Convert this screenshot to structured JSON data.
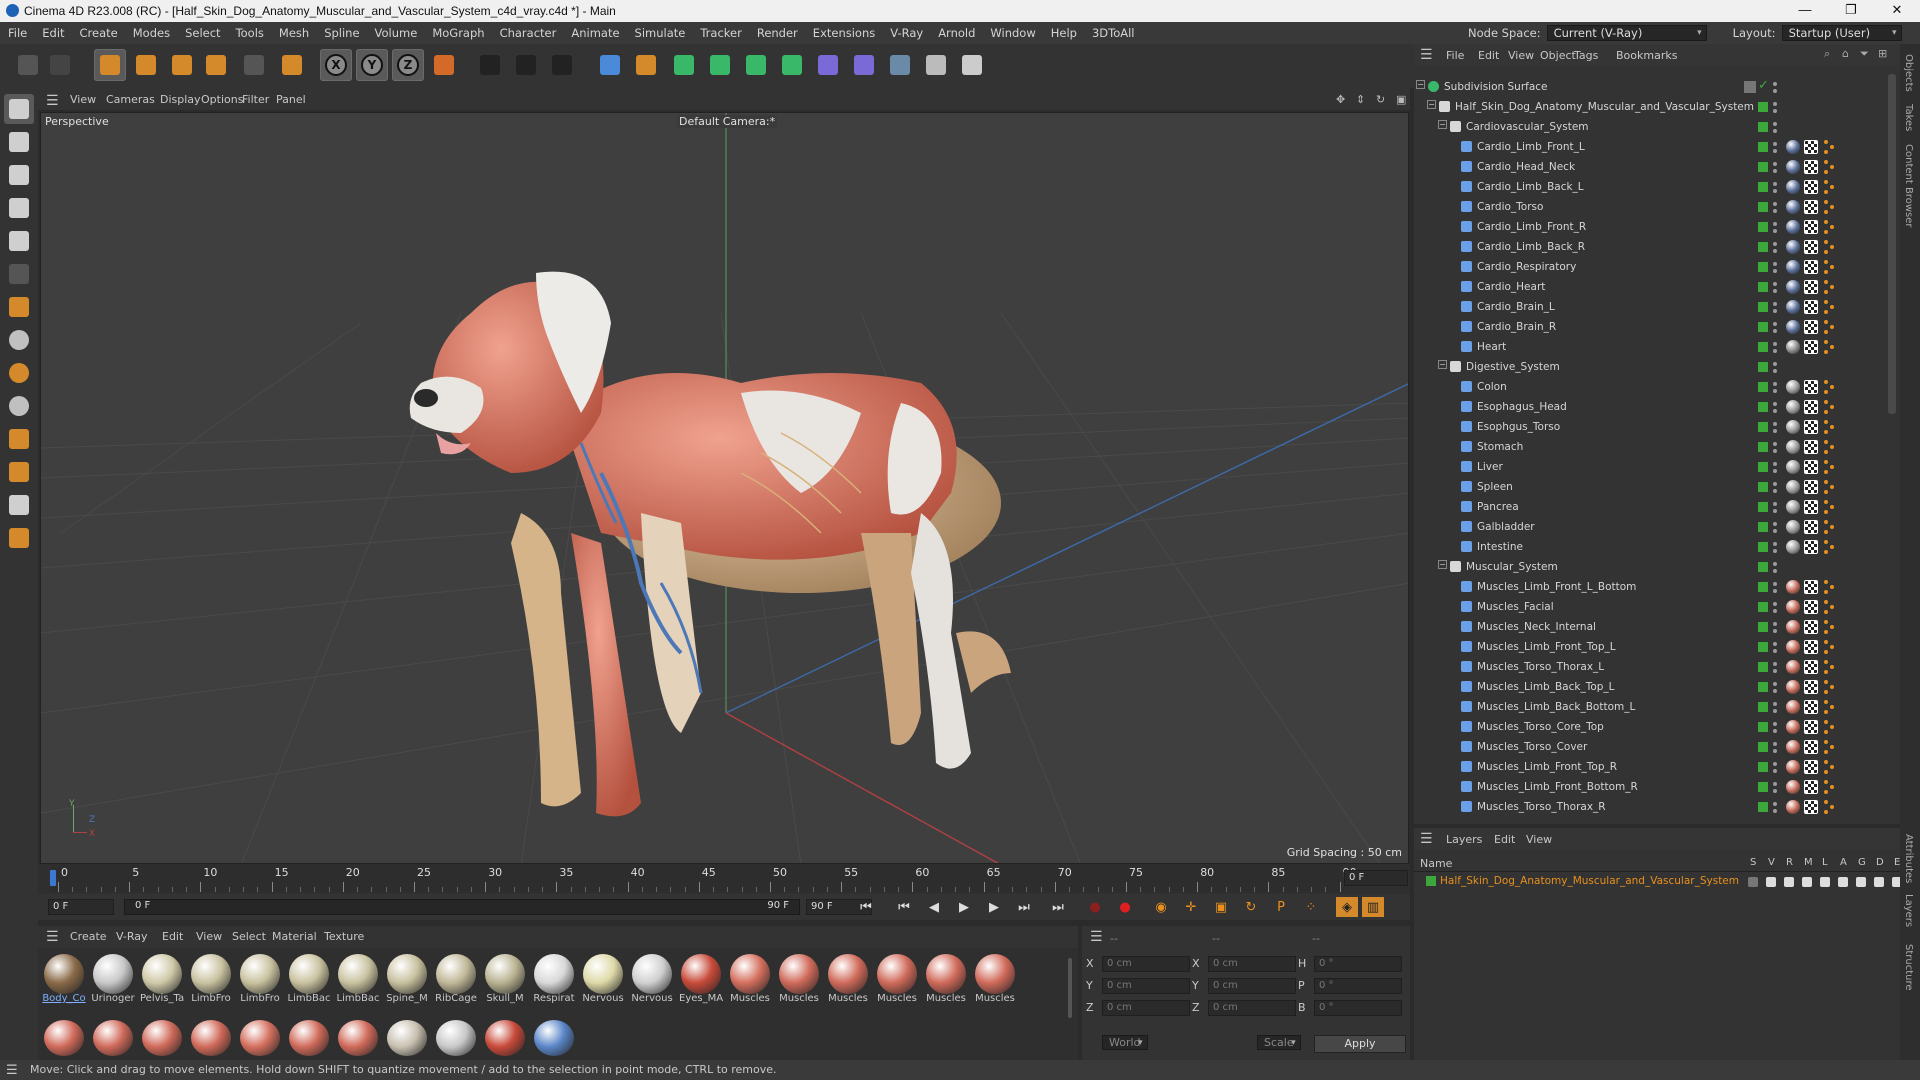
{
  "window": {
    "title": "Cinema 4D R23.008 (RC) - [Half_Skin_Dog_Anatomy_Muscular_and_Vascular_System_c4d_vray.c4d *] - Main",
    "minimize": "—",
    "maximize": "❐",
    "close": "✕"
  },
  "menubar": {
    "items": [
      "File",
      "Edit",
      "Create",
      "Modes",
      "Select",
      "Tools",
      "Mesh",
      "Spline",
      "Volume",
      "MoGraph",
      "Character",
      "Animate",
      "Simulate",
      "Tracker",
      "Render",
      "Extensions",
      "V-Ray",
      "Arnold",
      "Window",
      "Help",
      "3DToAll"
    ],
    "node_space_label": "Node Space:",
    "node_space_value": "Current (V-Ray)",
    "layout_label": "Layout:",
    "layout_value": "Startup (User)"
  },
  "toolbar": {
    "icons": [
      "undo-icon",
      "redo-icon",
      "live-selection-icon",
      "move-icon",
      "scale-icon",
      "rotate-icon",
      "recent-tools-icon",
      "add-icon",
      "x-axis-icon",
      "y-axis-icon",
      "z-axis-icon",
      "coordinate-system-icon",
      "render-view-icon",
      "render-picture-viewer-icon",
      "render-settings-icon",
      "cube-icon",
      "pen-icon",
      "subdivision-icon",
      "extrude-icon",
      "cloner-icon",
      "mograph-icon",
      "deformer-icon",
      "field-icon",
      "floor-icon",
      "camera-icon",
      "light-icon"
    ],
    "axis_x": "X",
    "axis_y": "Y",
    "axis_z": "Z"
  },
  "left_tools": [
    "model-mode-icon",
    "texture-mode-icon",
    "points-mode-icon",
    "edges-mode-icon",
    "polygons-mode-icon",
    "object-mode-icon",
    "axis-mode-icon",
    "snap-icon",
    "snap-settings-icon",
    "solo-icon",
    "tweak-icon",
    "workplane-icon",
    "grid-icon",
    "locked-workplane-icon"
  ],
  "viewport": {
    "menu": [
      "View",
      "Cameras",
      "Display",
      "Options",
      "Filter",
      "Panel"
    ],
    "view_name": "Perspective",
    "camera": "Default Camera",
    "camera_suffix": ":*",
    "grid_spacing": "Grid Spacing : 50 cm",
    "axis_y": "Y",
    "axis_z": "Z",
    "axis_x": "X"
  },
  "timeline": {
    "ticks": [
      "0",
      "5",
      "10",
      "15",
      "20",
      "25",
      "30",
      "35",
      "40",
      "45",
      "50",
      "55",
      "60",
      "65",
      "70",
      "75",
      "80",
      "85",
      "90"
    ],
    "current_frame": "0 F",
    "start": "0 F",
    "range_start": "0 F",
    "range_end": "90 F",
    "end": "90 F"
  },
  "material_manager": {
    "menu": [
      "Create",
      "V-Ray",
      "Edit",
      "View",
      "Select",
      "Material",
      "Texture"
    ],
    "materials": [
      "Body_Co",
      "Urinoger",
      "Pelvis_Ta",
      "LimbFro",
      "LimbFro",
      "LimbBac",
      "LimbBac",
      "Spine_M",
      "RibCage",
      "Skull_M",
      "Respirat",
      "Nervous",
      "Nervous",
      "Eyes_MA",
      "Muscles",
      "Muscles",
      "Muscles",
      "Muscles",
      "Muscles",
      "Muscles"
    ],
    "selected": "Body_Co"
  },
  "coordinates": {
    "headers": [
      "--",
      "--",
      "--"
    ],
    "rows": [
      {
        "a": "X",
        "av": "0 cm",
        "b": "X",
        "bv": "0 cm",
        "c": "H",
        "cv": "0 °"
      },
      {
        "a": "Y",
        "av": "0 cm",
        "b": "Y",
        "bv": "0 cm",
        "c": "P",
        "cv": "0 °"
      },
      {
        "a": "Z",
        "av": "0 cm",
        "b": "Z",
        "bv": "0 cm",
        "c": "B",
        "cv": "0 °"
      }
    ],
    "space": "World",
    "mode": "Scale",
    "apply": "Apply"
  },
  "status": "Move: Click and drag to move elements. Hold down SHIFT to quantize movement / add to the selection in point mode, CTRL to remove.",
  "object_manager": {
    "menu": [
      "File",
      "Edit",
      "View",
      "Object",
      "Tags",
      "Bookmarks"
    ],
    "rows": [
      {
        "name": "Subdivision Surface",
        "level": 0,
        "kind": "subdiv"
      },
      {
        "name": "Half_Skin_Dog_Anatomy_Muscular_and_Vascular_System",
        "level": 1,
        "kind": "null"
      },
      {
        "name": "Cardiovascular_System",
        "level": 2,
        "kind": "null"
      },
      {
        "name": "Cardio_Limb_Front_L",
        "level": 3,
        "kind": "mesh",
        "mat": "#5b6f9a"
      },
      {
        "name": "Cardio_Head_Neck",
        "level": 3,
        "kind": "mesh",
        "mat": "#5b6f9a"
      },
      {
        "name": "Cardio_Limb_Back_L",
        "level": 3,
        "kind": "mesh",
        "mat": "#5b6f9a"
      },
      {
        "name": "Cardio_Torso",
        "level": 3,
        "kind": "mesh",
        "mat": "#5b6f9a"
      },
      {
        "name": "Cardio_Limb_Front_R",
        "level": 3,
        "kind": "mesh",
        "mat": "#5b6f9a"
      },
      {
        "name": "Cardio_Limb_Back_R",
        "level": 3,
        "kind": "mesh",
        "mat": "#5b6f9a"
      },
      {
        "name": "Cardio_Respiratory",
        "level": 3,
        "kind": "mesh",
        "mat": "#5b6f9a"
      },
      {
        "name": "Cardio_Heart",
        "level": 3,
        "kind": "mesh",
        "mat": "#5b6f9a"
      },
      {
        "name": "Cardio_Brain_L",
        "level": 3,
        "kind": "mesh",
        "mat": "#5b6f9a"
      },
      {
        "name": "Cardio_Brain_R",
        "level": 3,
        "kind": "mesh",
        "mat": "#5b6f9a"
      },
      {
        "name": "Heart",
        "level": 3,
        "kind": "mesh",
        "mat": "#8a8a8a"
      },
      {
        "name": "Digestive_System",
        "level": 2,
        "kind": "null"
      },
      {
        "name": "Colon",
        "level": 3,
        "kind": "mesh",
        "mat": "#9a9a9a"
      },
      {
        "name": "Esophagus_Head",
        "level": 3,
        "kind": "mesh",
        "mat": "#9a9a9a"
      },
      {
        "name": "Esophgus_Torso",
        "level": 3,
        "kind": "mesh",
        "mat": "#9a9a9a"
      },
      {
        "name": "Stomach",
        "level": 3,
        "kind": "mesh",
        "mat": "#9a9a9a"
      },
      {
        "name": "Liver",
        "level": 3,
        "kind": "mesh",
        "mat": "#9a9a9a"
      },
      {
        "name": "Spleen",
        "level": 3,
        "kind": "mesh",
        "mat": "#9a9a9a"
      },
      {
        "name": "Pancrea",
        "level": 3,
        "kind": "mesh",
        "mat": "#9a9a9a"
      },
      {
        "name": "Galbladder",
        "level": 3,
        "kind": "mesh",
        "mat": "#9a9a9a"
      },
      {
        "name": "Intestine",
        "level": 3,
        "kind": "mesh",
        "mat": "#9a9a9a"
      },
      {
        "name": "Muscular_System",
        "level": 2,
        "kind": "null"
      },
      {
        "name": "Muscles_Limb_Front_L_Bottom",
        "level": 3,
        "kind": "mesh",
        "mat": "#c46a5a"
      },
      {
        "name": "Muscles_Facial",
        "level": 3,
        "kind": "mesh",
        "mat": "#c46a5a"
      },
      {
        "name": "Muscles_Neck_Internal",
        "level": 3,
        "kind": "mesh",
        "mat": "#c46a5a"
      },
      {
        "name": "Muscles_Limb_Front_Top_L",
        "level": 3,
        "kind": "mesh",
        "mat": "#c46a5a"
      },
      {
        "name": "Muscles_Torso_Thorax_L",
        "level": 3,
        "kind": "mesh",
        "mat": "#c46a5a"
      },
      {
        "name": "Muscles_Limb_Back_Top_L",
        "level": 3,
        "kind": "mesh",
        "mat": "#c46a5a"
      },
      {
        "name": "Muscles_Limb_Back_Bottom_L",
        "level": 3,
        "kind": "mesh",
        "mat": "#c46a5a"
      },
      {
        "name": "Muscles_Torso_Core_Top",
        "level": 3,
        "kind": "mesh",
        "mat": "#c46a5a"
      },
      {
        "name": "Muscles_Torso_Cover",
        "level": 3,
        "kind": "mesh",
        "mat": "#c46a5a"
      },
      {
        "name": "Muscles_Limb_Front_Top_R",
        "level": 3,
        "kind": "mesh",
        "mat": "#c46a5a"
      },
      {
        "name": "Muscles_Limb_Front_Bottom_R",
        "level": 3,
        "kind": "mesh",
        "mat": "#c46a5a"
      },
      {
        "name": "Muscles_Torso_Thorax_R",
        "level": 3,
        "kind": "mesh",
        "mat": "#c46a5a"
      }
    ]
  },
  "layers": {
    "menu": [
      "Layers",
      "Edit",
      "View"
    ],
    "name_header": "Name",
    "columns": [
      "S",
      "V",
      "R",
      "M",
      "L",
      "A",
      "G",
      "D",
      "E"
    ],
    "layer_name": "Half_Skin_Dog_Anatomy_Muscular_and_Vascular_System",
    "layer_color": "#3ca83c"
  },
  "side_tabs": [
    "Objects",
    "Takes",
    "Content Browser",
    "Attributes",
    "Layers",
    "Structure"
  ],
  "colors": {
    "accent_orange": "#e8901d",
    "check_green": "#3ca83c",
    "selected_label": "#e8901d"
  }
}
